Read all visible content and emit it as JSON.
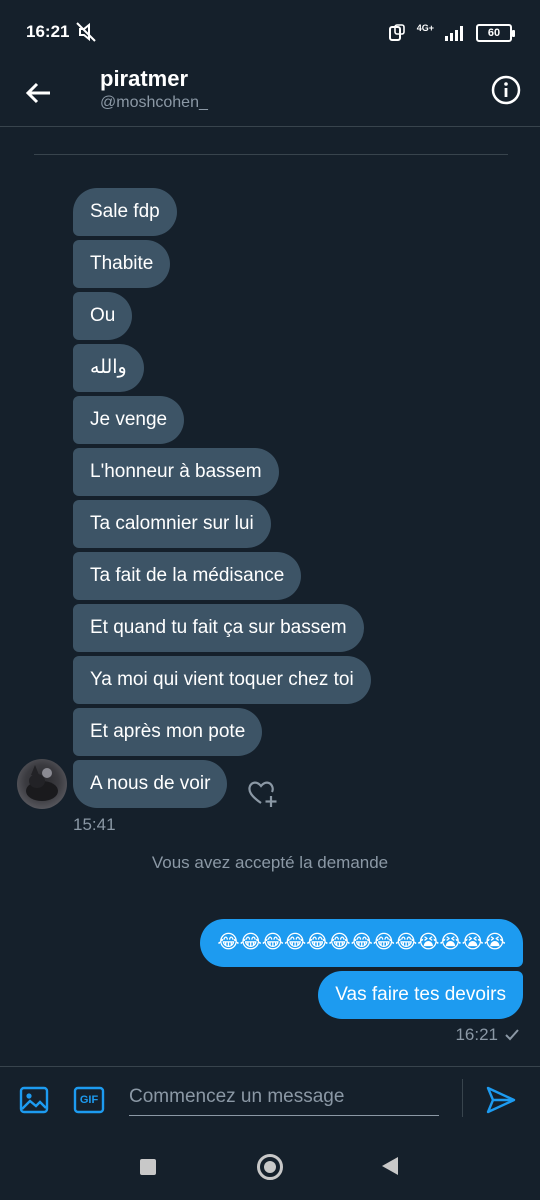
{
  "status_bar": {
    "time": "16:21",
    "network": "4G+",
    "battery": "60"
  },
  "header": {
    "name": "piratmer",
    "handle": "@moshcohen_"
  },
  "received_messages": [
    "Sale fdp",
    "Thabite",
    "Ou",
    "والله",
    "Je venge",
    "L'honneur à bassem",
    "Ta calomnier sur lui",
    "Ta fait de la médisance",
    "Et quand tu fait ça sur bassem",
    "Ya moi qui vient toquer chez toi",
    "Et après mon pote",
    "A nous de voir"
  ],
  "received_time": "15:41",
  "system_note": "Vous avez accepté la demande",
  "sent_messages": [
    "😂😂😂😂😂😂😂😂😂😭😭😭😭",
    "Vas faire tes devoirs"
  ],
  "sent_time": "16:21",
  "composer": {
    "placeholder": "Commencez un message",
    "gif_label": "GIF"
  },
  "colors": {
    "background": "#15202b",
    "received_bubble": "#3d5466",
    "sent_bubble": "#1d9bf0",
    "muted_text": "#8b98a5"
  }
}
